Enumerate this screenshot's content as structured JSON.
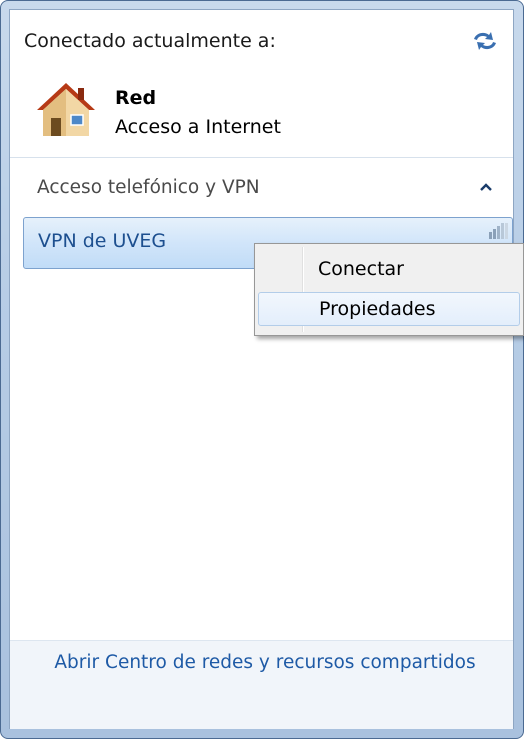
{
  "header": {
    "title": "Conectado actualmente a:",
    "refresh_icon": "refresh-arrows-icon"
  },
  "network": {
    "name": "Red",
    "status": "Acceso a Internet",
    "icon": "home-network-icon"
  },
  "dialup_section": {
    "title": "Acceso telefónico y VPN",
    "collapse_icon": "chevron-up-icon"
  },
  "vpn": {
    "name": "VPN de UVEG",
    "icon": "vpn-signal-icon"
  },
  "context_menu": {
    "items": [
      {
        "label": "Conectar"
      },
      {
        "label": "Propiedades"
      }
    ]
  },
  "footer": {
    "link": "Abrir Centro de redes y recursos compartidos"
  },
  "colors": {
    "link": "#1e5aa6",
    "selection": "#c1dcf7",
    "frame": "#b7cde6"
  }
}
